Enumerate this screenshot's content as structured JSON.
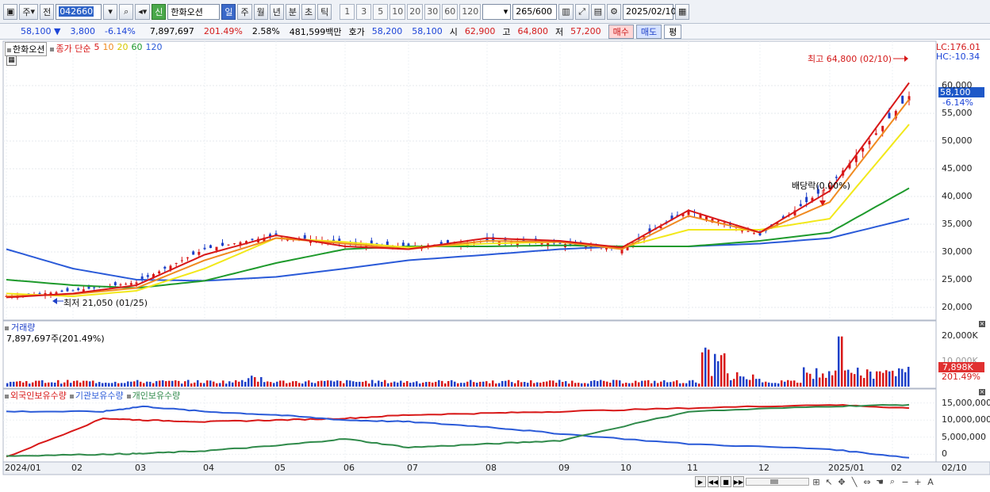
{
  "toolbar": {
    "market": "주",
    "prev": "전",
    "code": "042660",
    "name": "한화오션",
    "name_badge": "신",
    "periods": [
      "일",
      "주",
      "월",
      "년",
      "분",
      "초",
      "틱"
    ],
    "active_period": 0,
    "intervals": [
      "1",
      "3",
      "5",
      "10",
      "20",
      "30",
      "60",
      "120"
    ],
    "count": "265",
    "count_total": "/600",
    "date": "2025/02/10"
  },
  "quote": {
    "price": "58,100",
    "arrow": "▼",
    "change": "3,800",
    "change_pct": "-6.14%",
    "volume": "7,897,697",
    "volume_ratio": "201.49%",
    "turnover_pct": "2.58%",
    "amount": "481,599백만",
    "hoga_label": "호가",
    "ask": "58,200",
    "bid": "58,100",
    "open_label": "시",
    "open": "62,900",
    "high_label": "고",
    "high": "64,800",
    "low_label": "저",
    "low": "57,200",
    "buy": "매수",
    "sell": "매도",
    "eval": "평"
  },
  "price_panel": {
    "legend_name": "한화오션",
    "legend_title": "종가 단순",
    "ma_periods": [
      "5",
      "10",
      "20",
      "60",
      "120"
    ],
    "ma_colors": [
      "#d81818",
      "#f08a20",
      "#f2e81a",
      "#1e9a2c",
      "#2a5ad8"
    ],
    "lc": "LC:176.01",
    "hc": "HC:-10.34",
    "high_marker": "최고 64,800 (02/10)",
    "low_marker": "최저 21,050 (01/25)",
    "dividend": "배당락(0.00%)",
    "current_price": "58,100",
    "current_pct": "-6.14%",
    "y_ticks": [
      "60,000",
      "55,000",
      "50,000",
      "45,000",
      "40,000",
      "35,000",
      "30,000",
      "25,000",
      "20,000"
    ]
  },
  "volume_panel": {
    "title": "거래량",
    "value": "7,897,697주(201.49%)",
    "y_tick": "20,000K",
    "y_tick2": "10,000K",
    "current": "7,898K",
    "current_pct": "201.49%"
  },
  "holdings_panel": {
    "legend": [
      "외국인보유수량",
      "기관보유수량",
      "개인보유수량"
    ],
    "colors": [
      "#d81818",
      "#2a5ad8",
      "#2f8a4a"
    ],
    "y_ticks": [
      "15,000,000",
      "10,000,000",
      "5,000,000",
      "0"
    ]
  },
  "x_axis": {
    "labels": [
      "2024/01",
      "02",
      "03",
      "04",
      "05",
      "06",
      "07",
      "08",
      "09",
      "10",
      "11",
      "12",
      "2025/01",
      "02"
    ],
    "end_label": "02/10"
  },
  "chart_data": [
    {
      "type": "line",
      "title": "",
      "ylim": [
        18000,
        66000
      ],
      "ohlc_close_approx": {
        "x": [
          "2024/01",
          "2024/02",
          "2024/03",
          "2024/04",
          "2024/05",
          "2024/06",
          "2024/07",
          "2024/08",
          "2024/09",
          "2024/10",
          "2024/11",
          "2024/12",
          "2025/01",
          "2025/02"
        ],
        "close": [
          22000,
          23000,
          24500,
          30500,
          33000,
          31500,
          31000,
          32000,
          31500,
          30500,
          37500,
          33000,
          42000,
          58100
        ]
      },
      "series": [
        {
          "name": "5",
          "values": [
            21800,
            22500,
            24000,
            29500,
            33000,
            31000,
            30500,
            32500,
            32000,
            30800,
            37500,
            33500,
            41000,
            60500
          ]
        },
        {
          "name": "10",
          "values": [
            22000,
            22400,
            23500,
            28500,
            32500,
            31500,
            30500,
            32000,
            31800,
            30500,
            36500,
            33500,
            39000,
            57500
          ]
        },
        {
          "name": "20",
          "values": [
            22500,
            22000,
            23000,
            27000,
            32500,
            31800,
            30800,
            31500,
            31800,
            30800,
            34000,
            34000,
            36000,
            53000
          ]
        },
        {
          "name": "60",
          "values": [
            25000,
            24000,
            23500,
            24800,
            28000,
            30500,
            31000,
            31000,
            31200,
            31000,
            31000,
            32000,
            33500,
            41500
          ]
        },
        {
          "name": "120",
          "values": [
            30500,
            27000,
            25000,
            24800,
            25500,
            27000,
            28500,
            29500,
            30500,
            31000,
            31000,
            31500,
            32500,
            36000
          ]
        }
      ]
    },
    {
      "type": "bar",
      "title": "거래량",
      "ylim": [
        0,
        24000
      ],
      "highlights": {
        "x": [
          "2024/11",
          "2024/11",
          "2025/01",
          "2025/02"
        ],
        "values": [
          13000,
          16000,
          20000,
          7898
        ]
      }
    },
    {
      "type": "line",
      "ylim": [
        -2000000,
        17000000
      ],
      "series": [
        {
          "name": "외국인보유수량",
          "values": [
            -800000,
            10500000,
            10000000,
            9500000,
            10000000,
            10500000,
            11500000,
            12000000,
            12500000,
            13500000,
            14500000,
            13500000
          ]
        },
        {
          "name": "기관보유수량",
          "values": [
            12500000,
            12500000,
            14000000,
            12500000,
            11500000,
            10000000,
            9500000,
            8000000,
            6000000,
            3000000,
            1500000,
            -1000000
          ]
        },
        {
          "name": "개인보유수량",
          "values": [
            -500000,
            0,
            200000,
            1000000,
            2500000,
            4500000,
            2000000,
            3000000,
            4000000,
            12500000,
            14000000,
            14500000
          ]
        }
      ]
    }
  ]
}
